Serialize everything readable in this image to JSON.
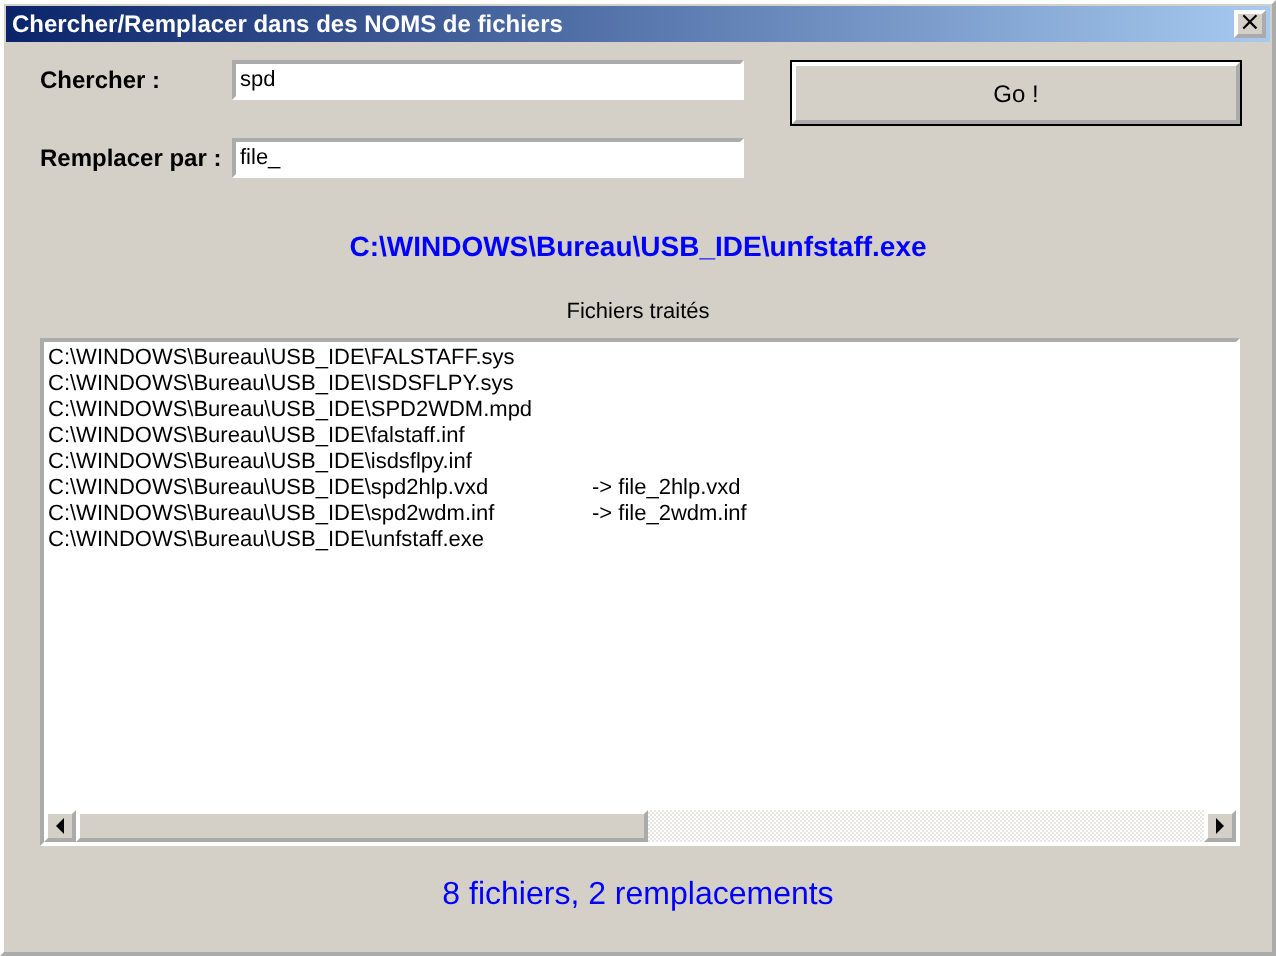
{
  "window": {
    "title": "Chercher/Remplacer dans des NOMS de fichiers",
    "close": "×"
  },
  "search": {
    "label": "Chercher :",
    "value": "spd"
  },
  "replace": {
    "label": "Remplacer par :",
    "value": "file_"
  },
  "go_button": "Go !",
  "current_file": "C:\\WINDOWS\\Bureau\\USB_IDE\\unfstaff.exe",
  "list_title": "Fichiers traités",
  "files": [
    {
      "path": "C:\\WINDOWS\\Bureau\\USB_IDE\\FALSTAFF.sys"
    },
    {
      "path": "C:\\WINDOWS\\Bureau\\USB_IDE\\ISDSFLPY.sys"
    },
    {
      "path": "C:\\WINDOWS\\Bureau\\USB_IDE\\SPD2WDM.mpd"
    },
    {
      "path": "C:\\WINDOWS\\Bureau\\USB_IDE\\falstaff.inf"
    },
    {
      "path": "C:\\WINDOWS\\Bureau\\USB_IDE\\isdsflpy.inf"
    },
    {
      "path": "C:\\WINDOWS\\Bureau\\USB_IDE\\spd2hlp.vxd",
      "result": "-> file_2hlp.vxd"
    },
    {
      "path": "C:\\WINDOWS\\Bureau\\USB_IDE\\spd2wdm.inf",
      "result": "-> file_2wdm.inf"
    },
    {
      "path": "C:\\WINDOWS\\Bureau\\USB_IDE\\unfstaff.exe"
    }
  ],
  "status": "8 fichiers, 2 remplacements"
}
